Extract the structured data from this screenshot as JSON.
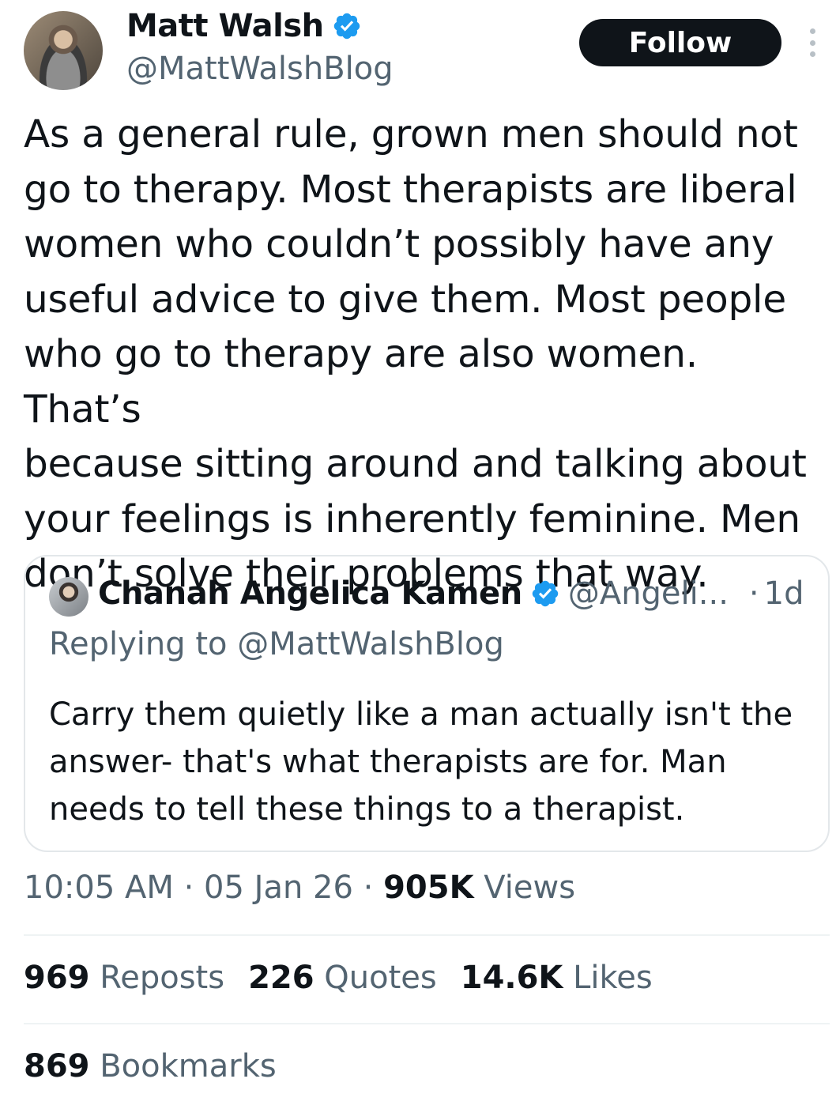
{
  "author": {
    "name": "Matt Walsh",
    "handle": "@MattWalshBlog",
    "verified": true
  },
  "follow_button": {
    "label": "Follow"
  },
  "tweet": {
    "text": "As a general rule, grown men should not\ngo to therapy. Most therapists are liberal\nwomen who couldn’t possibly have any\nuseful advice to give them. Most people\nwho go to therapy are also women. That’s\nbecause sitting around and talking about\nyour feelings is inherently feminine. Men\ndon’t solve their problems that way."
  },
  "quote": {
    "name": "Chanah Angelica Kamen",
    "handle": "@Angeli...",
    "dot": "·",
    "time": "1d",
    "replying_to": "Replying to @MattWalshBlog",
    "text": "Carry them quietly like a man actually isn't the\nanswer- that's what therapists are for. Man\nneeds to tell these things to a therapist."
  },
  "meta": {
    "time": "10:05 AM",
    "sep1": "·",
    "date": "05 Jan 26",
    "sep2": "·",
    "views_count": "905K",
    "views_label": "Views"
  },
  "stats": {
    "reposts_count": "969",
    "reposts_label": "Reposts",
    "quotes_count": "226",
    "quotes_label": "Quotes",
    "likes_count": "14.6K",
    "likes_label": "Likes",
    "bookmarks_count": "869",
    "bookmarks_label": "Bookmarks"
  },
  "colors": {
    "text": "#0f1419",
    "secondary": "#536471",
    "verified_blue": "#1d9bf0",
    "button_bg": "#0f1419",
    "border": "#e3e7ea"
  },
  "icons": [
    "verified-badge-icon",
    "more-options-icon"
  ]
}
